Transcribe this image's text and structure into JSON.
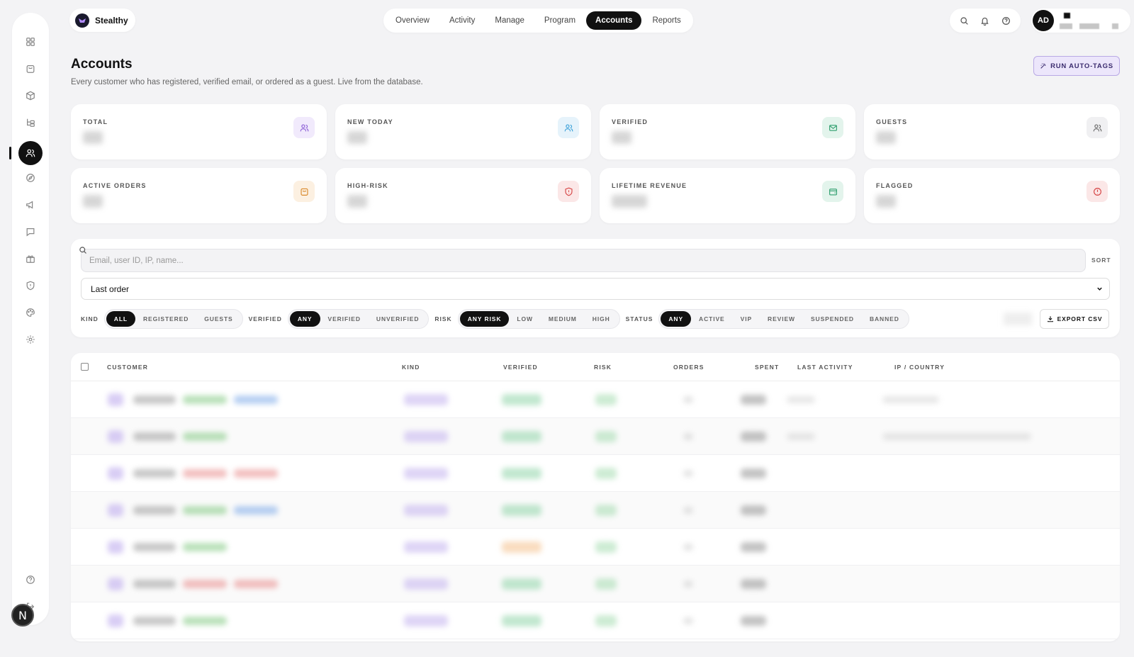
{
  "brand": {
    "name": "Stealthy"
  },
  "nav": {
    "tabs": [
      {
        "label": "Overview"
      },
      {
        "label": "Activity"
      },
      {
        "label": "Manage"
      },
      {
        "label": "Program"
      },
      {
        "label": "Accounts",
        "active": true
      },
      {
        "label": "Reports"
      }
    ]
  },
  "user": {
    "initials": "AD"
  },
  "sidebar": {
    "icons": [
      "dashboard-icon",
      "shopping-bag-icon",
      "box-icon",
      "tree-icon",
      "users-icon",
      "compass-icon",
      "megaphone-icon",
      "message-icon",
      "gift-icon",
      "shield-icon",
      "palette-icon",
      "settings-icon",
      "help-icon",
      "logout-icon"
    ],
    "active": "users-icon",
    "badge": "N"
  },
  "header": {
    "title": "Accounts",
    "subtitle": "Every customer who has registered, verified email, or ordered as a guest. Live from the database.",
    "run_button": "RUN AUTO-TAGS"
  },
  "stats": [
    {
      "label": "TOTAL",
      "icon": "users-icon",
      "color": "#8a5cd6"
    },
    {
      "label": "NEW TODAY",
      "icon": "users-icon",
      "color": "#3aa0d8"
    },
    {
      "label": "VERIFIED",
      "icon": "mail-icon",
      "color": "#2f9e6e"
    },
    {
      "label": "GUESTS",
      "icon": "users-icon",
      "color": "#666666"
    },
    {
      "label": "ACTIVE ORDERS",
      "icon": "shopping-bag-icon",
      "color": "#d9892b"
    },
    {
      "label": "HIGH-RISK",
      "icon": "shield-icon",
      "color": "#d64545"
    },
    {
      "label": "LIFETIME REVENUE",
      "icon": "wallet-icon",
      "color": "#2f9e6e"
    },
    {
      "label": "FLAGGED",
      "icon": "alert-icon",
      "color": "#d64545"
    }
  ],
  "filters": {
    "search_placeholder": "Email, user ID, IP, name...",
    "sort_label": "SORT",
    "sort_value": "Last order",
    "kind": {
      "label": "KIND",
      "options": [
        "ALL",
        "REGISTERED",
        "GUESTS"
      ],
      "selected": "ALL"
    },
    "verified": {
      "label": "VERIFIED",
      "options": [
        "ANY",
        "VERIFIED",
        "UNVERIFIED"
      ],
      "selected": "ANY"
    },
    "risk": {
      "label": "RISK",
      "options": [
        "ANY RISK",
        "LOW",
        "MEDIUM",
        "HIGH"
      ],
      "selected": "ANY RISK"
    },
    "status": {
      "label": "STATUS",
      "options": [
        "ANY",
        "ACTIVE",
        "VIP",
        "REVIEW",
        "SUSPENDED",
        "BANNED"
      ],
      "selected": "ANY"
    },
    "export_label": "EXPORT CSV"
  },
  "table": {
    "columns": [
      "CUSTOMER",
      "KIND",
      "VERIFIED",
      "RISK",
      "ORDERS",
      "SPENT",
      "LAST ACTIVITY",
      "IP / COUNTRY"
    ]
  }
}
